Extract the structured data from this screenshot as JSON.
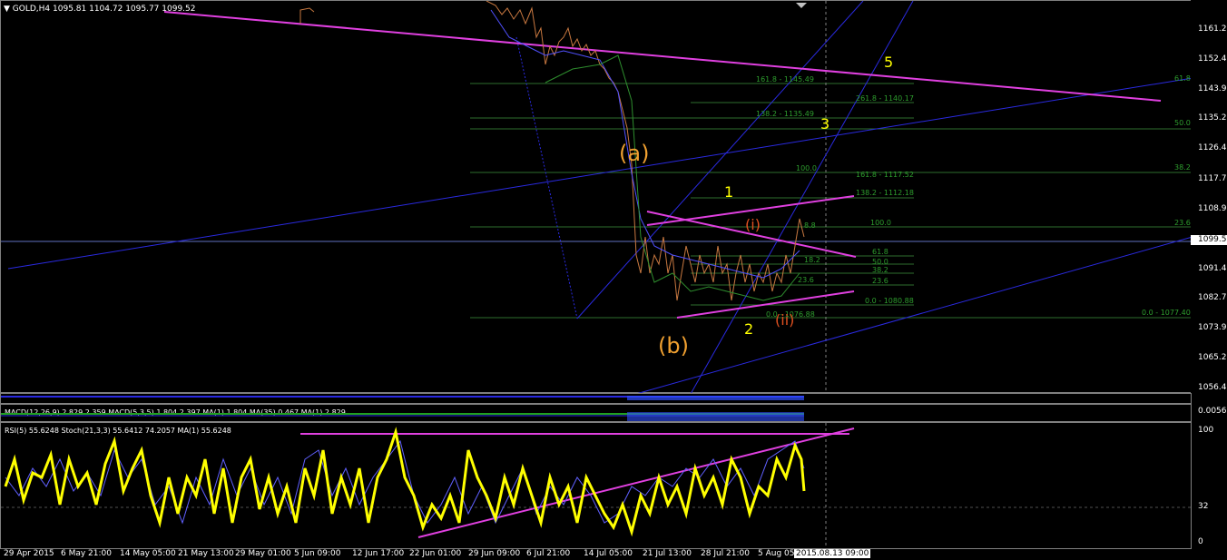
{
  "header": {
    "symbol_tf": "GOLD,H4",
    "ohlc": "1095.81 1104.72 1095.77 1099.52"
  },
  "price_axis": [
    "1161.21",
    "1152.46",
    "1143.96",
    "1135.21",
    "1126.46",
    "1117.71",
    "1108.96",
    "1099.52",
    "1091.46",
    "1082.71",
    "1073.96",
    "1065.21",
    "1056.46"
  ],
  "current_price": "1099.52",
  "fib_labels": {
    "f1": "161.8 - 1145.49",
    "f2": "261.8 - 1140.17",
    "f3": "138.2 - 1135.49",
    "f4": "100.0",
    "f5": "161.8 - 1117.52",
    "f6": "138.2 - 1112.18",
    "f7": "100.0",
    "f8": "61.8",
    "f9": "50.0",
    "f10": "38.2",
    "f11": "23.6",
    "f12": "0.0 - 1080.88",
    "f13": "0.0 - 1076.88",
    "r1": "61.8",
    "r2": "50.0",
    "r3": "38.2",
    "r4": "23.6",
    "r5": "0.0 - 1077.40",
    "m1": "61.8",
    "m2": "50.0",
    "m3": "38.2",
    "m4": "23.6",
    "m5": "8.8",
    "m6": "18.2"
  },
  "wave_labels": {
    "a": "(a)",
    "b": "(b)",
    "i": "(i)",
    "ii": "(ii)",
    "w1": "1",
    "w2": "2",
    "w3": "3",
    "w5": "5"
  },
  "macd_header": "MACD(12,26,9) 2.829 2.359  MACD(5,3,5) 1.804 2.397  MA(1) 1.804  MA(35) 0.467  MA(1) 2.829",
  "macd_axis": [
    "0.0056"
  ],
  "rsi_header": "RSI(5) 55.6248  Stoch(21,3,3) 55.6412 74.2057  MA(1) 55.6248",
  "rsi_axis": [
    "100",
    "32",
    "0"
  ],
  "time_axis": [
    "29 Apr 2015",
    "6 May 21:00",
    "14 May 05:00",
    "21 May 13:00",
    "29 May 01:00",
    "5 Jun 09:00",
    "12 Jun 17:00",
    "22 Jun 01:00",
    "29 Jun 09:00",
    "6 Jul 21:00",
    "14 Jul 05:00",
    "21 Jul 13:00",
    "28 Jul 21:00",
    "5 Aug 05:00"
  ],
  "time_cursor": "2015.08.13 09:00",
  "colors": {
    "background": "#000000",
    "candle": "#c87840",
    "fib": "#2e7d2e",
    "trend_magenta": "#e040e0",
    "trend_blue": "#2a2ae0",
    "wave_orange": "#f0a030",
    "wave_yellow": "#ffff00",
    "rsi": "#ffff00"
  }
}
